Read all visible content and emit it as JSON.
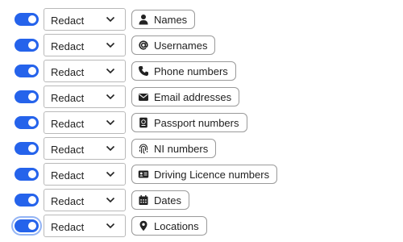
{
  "colors": {
    "accent": "#2563eb",
    "border": "#b9b9b9",
    "text": "#1f1f1f"
  },
  "rows": [
    {
      "enabled": true,
      "mode": "Redact",
      "label": "Names",
      "icon": "person-icon"
    },
    {
      "enabled": true,
      "mode": "Redact",
      "label": "Usernames",
      "icon": "at-sign-icon"
    },
    {
      "enabled": true,
      "mode": "Redact",
      "label": "Phone numbers",
      "icon": "phone-icon"
    },
    {
      "enabled": true,
      "mode": "Redact",
      "label": "Email addresses",
      "icon": "envelope-icon"
    },
    {
      "enabled": true,
      "mode": "Redact",
      "label": "Passport numbers",
      "icon": "passport-icon"
    },
    {
      "enabled": true,
      "mode": "Redact",
      "label": "NI numbers",
      "icon": "fingerprint-icon"
    },
    {
      "enabled": true,
      "mode": "Redact",
      "label": "Driving Licence numbers",
      "icon": "id-card-icon"
    },
    {
      "enabled": true,
      "mode": "Redact",
      "label": "Dates",
      "icon": "calendar-icon"
    },
    {
      "enabled": true,
      "mode": "Redact",
      "label": "Locations",
      "icon": "location-pin-icon"
    }
  ]
}
